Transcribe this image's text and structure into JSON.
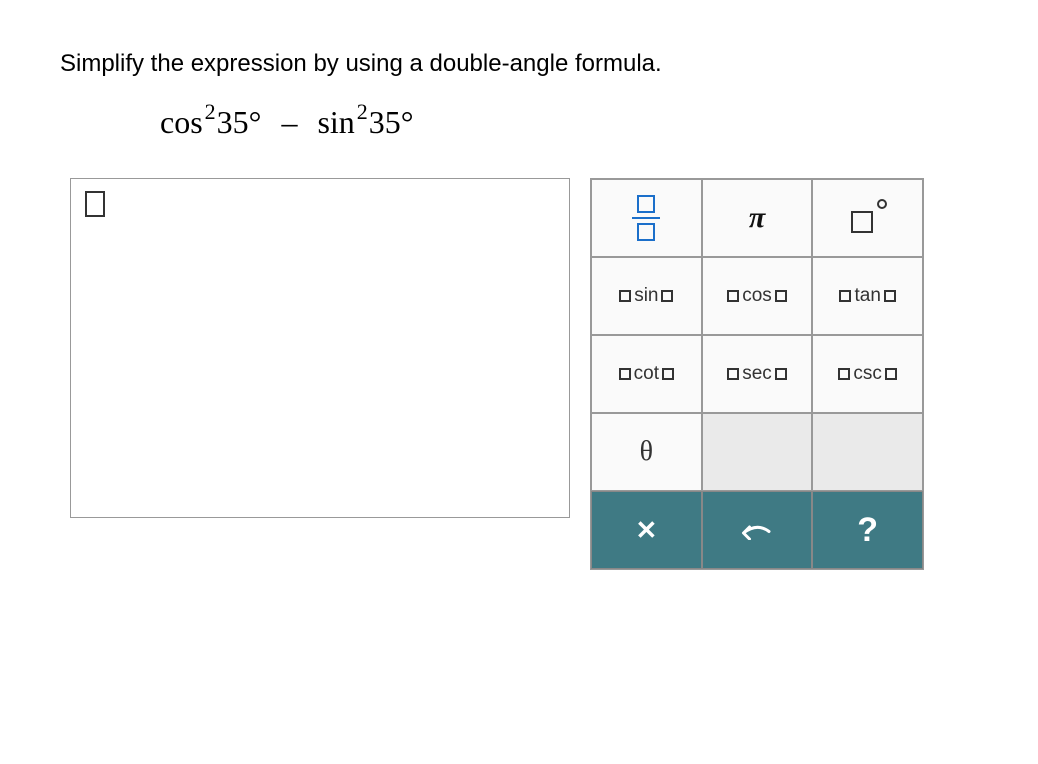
{
  "instruction": "Simplify the expression by using a double-angle formula.",
  "expression": {
    "term1_func": "cos",
    "term1_exp": "2",
    "term1_arg": "35°",
    "operator": "–",
    "term2_func": "sin",
    "term2_exp": "2",
    "term2_arg": "35°"
  },
  "keypad": {
    "pi": "π",
    "sin": "sin",
    "cos": "cos",
    "tan": "tan",
    "cot": "cot",
    "sec": "sec",
    "csc": "csc",
    "theta": "θ",
    "close": "✕",
    "help": "?"
  }
}
